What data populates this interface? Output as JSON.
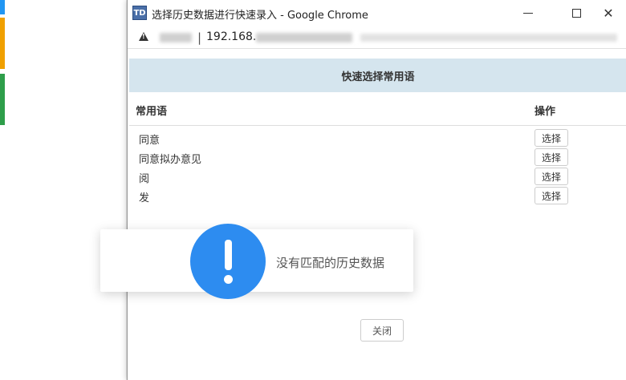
{
  "window": {
    "app_icon_text": "TD",
    "title": "选择历史数据进行快速录入 - Google Chrome"
  },
  "address": {
    "url_visible": "192.168."
  },
  "panel": {
    "header": "快速选择常用语",
    "col_phrase": "常用语",
    "col_ops": "操作"
  },
  "rows": [
    {
      "text": "同意",
      "action": "选择"
    },
    {
      "text": "同意拟办意见",
      "action": "选择"
    },
    {
      "text": "阅",
      "action": "选择"
    },
    {
      "text": "发",
      "action": "选择"
    }
  ],
  "toast": {
    "message": "没有匹配的历史数据",
    "icon": "exclamation-icon",
    "color": "#2d8cf0"
  },
  "footer": {
    "close_label": "关闭"
  }
}
